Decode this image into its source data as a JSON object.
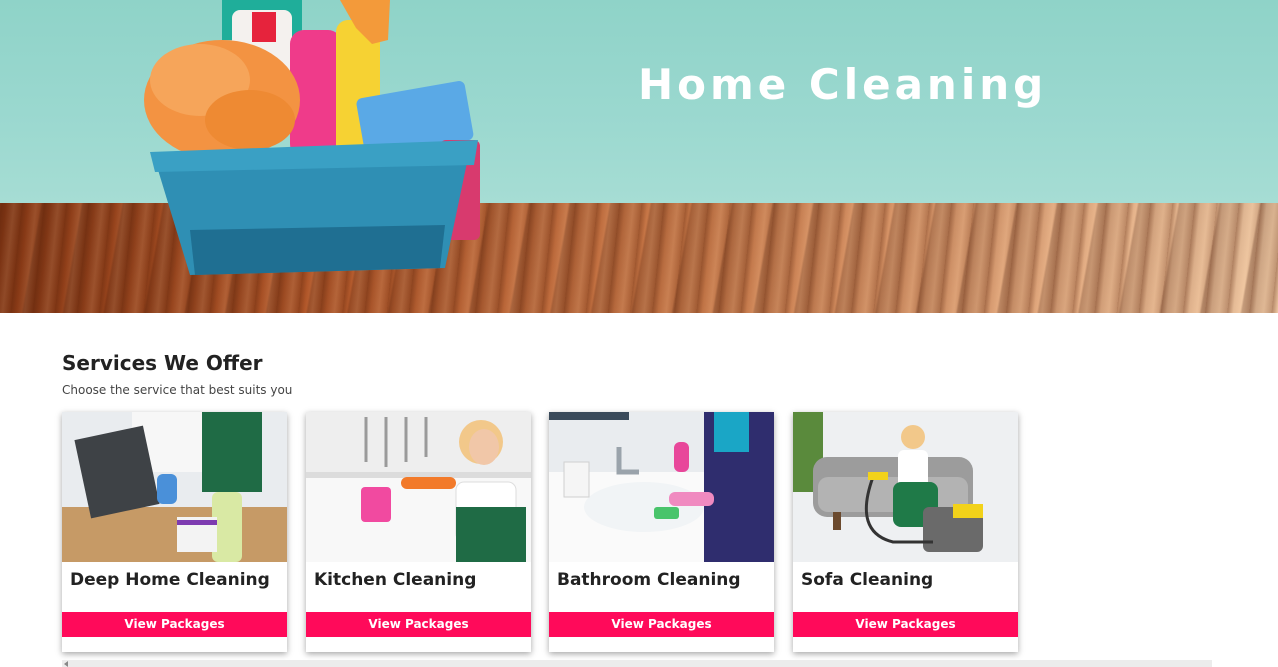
{
  "hero": {
    "title": "Home Cleaning",
    "image_icon": "cleaning-supplies-bucket-image"
  },
  "services": {
    "title": "Services We Offer",
    "subtitle": "Choose the service that best suits you",
    "cards": [
      {
        "title": "Deep Home Cleaning",
        "button_label": "View Packages",
        "image_icon": "desk-cleaning-image"
      },
      {
        "title": "Kitchen Cleaning",
        "button_label": "View Packages",
        "image_icon": "kitchen-cleaning-image"
      },
      {
        "title": "Bathroom Cleaning",
        "button_label": "View Packages",
        "image_icon": "sink-cleaning-image"
      },
      {
        "title": "Sofa Cleaning",
        "button_label": "View Packages",
        "image_icon": "sofa-vacuum-image"
      }
    ]
  },
  "colors": {
    "accent": "#ff0a5a",
    "hero_wall": "#8fd3c8",
    "text": "#222222"
  }
}
